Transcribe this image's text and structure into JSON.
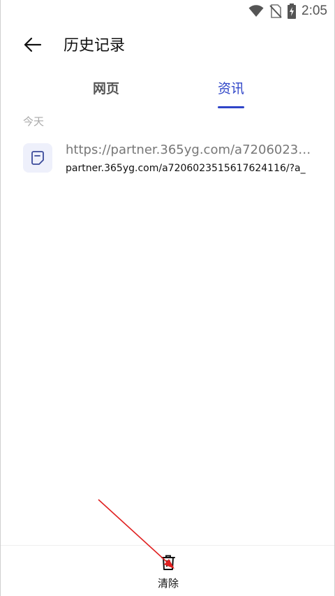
{
  "status_bar": {
    "time": "2:05",
    "icons": [
      "wifi-icon",
      "no-sim-icon",
      "battery-charging-icon"
    ]
  },
  "header": {
    "back_icon": "arrow-left-icon",
    "title": "历史记录"
  },
  "tabs": [
    {
      "label": "网页",
      "active": false
    },
    {
      "label": "资讯",
      "active": true
    }
  ],
  "section": {
    "label": "今天",
    "items": [
      {
        "icon": "document-icon",
        "title": "https://partner.365yg.com/a7206023515…",
        "subtitle": "partner.365yg.com/a7206023515617624116/?a_"
      }
    ]
  },
  "bottom_bar": {
    "clear_icon": "trash-icon",
    "clear_label": "清除"
  },
  "colors": {
    "accent": "#2f45c8",
    "icon_bg": "#eef0fb",
    "annotation_arrow": "#e02020"
  }
}
